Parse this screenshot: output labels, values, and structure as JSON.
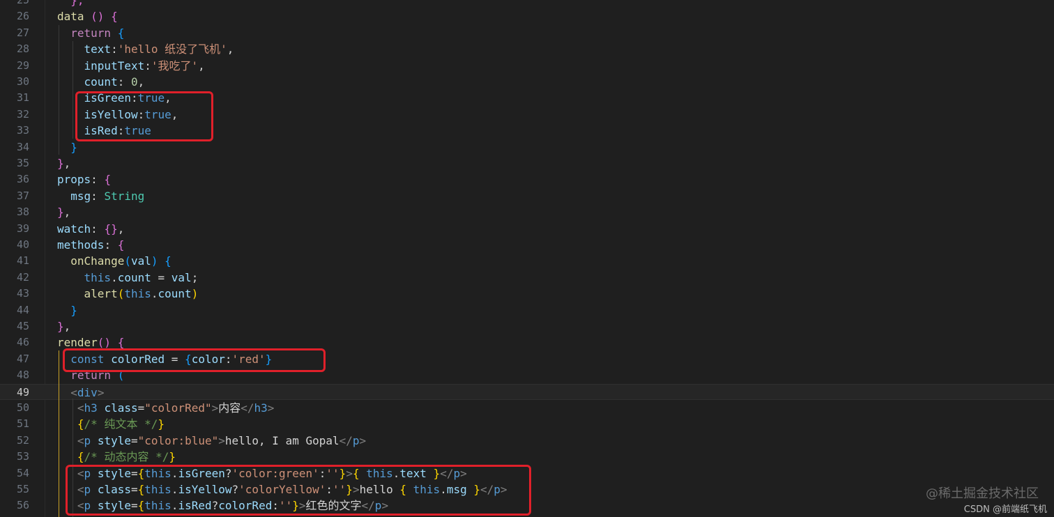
{
  "colors": {
    "background": "#1f1f1f",
    "plain": "#d4d4d4",
    "keyword": "#c586c0",
    "variable": "#9cdcfe",
    "function": "#dcdcaa",
    "string": "#ce9178",
    "boolean": "#569cd6",
    "number": "#b5cea8",
    "type": "#4ec9b0",
    "bracket1": "#ffd700",
    "bracket2": "#da70d6",
    "bracket3": "#179fff",
    "tag": "#569cd6",
    "tagAngle": "#808080",
    "attr": "#9cdcfe",
    "comment": "#6a9955",
    "highlight_box": "#e0202a"
  },
  "lines": [
    {
      "n": "25",
      "t": [
        [
          "  ",
          "plain"
        ],
        [
          "},",
          "bracket2"
        ]
      ]
    },
    {
      "n": "26",
      "t": [
        [
          "data",
          "function"
        ],
        [
          " ",
          "plain"
        ],
        [
          "()",
          "bracket2"
        ],
        [
          " ",
          "plain"
        ],
        [
          "{",
          "bracket2"
        ]
      ]
    },
    {
      "n": "27",
      "t": [
        [
          "  ",
          "plain"
        ],
        [
          "return",
          "keyword"
        ],
        [
          " ",
          "plain"
        ],
        [
          "{",
          "bracket3"
        ]
      ]
    },
    {
      "n": "28",
      "t": [
        [
          "    ",
          "plain"
        ],
        [
          "text",
          "variable"
        ],
        [
          ":",
          "plain"
        ],
        [
          "'hello 纸没了飞机'",
          "string"
        ],
        [
          ",",
          "plain"
        ]
      ]
    },
    {
      "n": "29",
      "t": [
        [
          "    ",
          "plain"
        ],
        [
          "inputText",
          "variable"
        ],
        [
          ":",
          "plain"
        ],
        [
          "'我吃了'",
          "string"
        ],
        [
          ",",
          "plain"
        ]
      ]
    },
    {
      "n": "30",
      "t": [
        [
          "    ",
          "plain"
        ],
        [
          "count",
          "variable"
        ],
        [
          ": ",
          "plain"
        ],
        [
          "0",
          "number"
        ],
        [
          ",",
          "plain"
        ]
      ]
    },
    {
      "n": "31",
      "t": [
        [
          "    ",
          "plain"
        ],
        [
          "isGreen",
          "variable"
        ],
        [
          ":",
          "plain"
        ],
        [
          "true",
          "boolean"
        ],
        [
          ",",
          "plain"
        ]
      ]
    },
    {
      "n": "32",
      "t": [
        [
          "    ",
          "plain"
        ],
        [
          "isYellow",
          "variable"
        ],
        [
          ":",
          "plain"
        ],
        [
          "true",
          "boolean"
        ],
        [
          ",",
          "plain"
        ]
      ]
    },
    {
      "n": "33",
      "t": [
        [
          "    ",
          "plain"
        ],
        [
          "isRed",
          "variable"
        ],
        [
          ":",
          "plain"
        ],
        [
          "true",
          "boolean"
        ]
      ]
    },
    {
      "n": "34",
      "t": [
        [
          "  ",
          "plain"
        ],
        [
          "}",
          "bracket3"
        ]
      ]
    },
    {
      "n": "35",
      "t": [
        [
          "}",
          "bracket2"
        ],
        [
          ",",
          "plain"
        ]
      ]
    },
    {
      "n": "36",
      "t": [
        [
          "props",
          "variable"
        ],
        [
          ": ",
          "plain"
        ],
        [
          "{",
          "bracket2"
        ]
      ]
    },
    {
      "n": "37",
      "t": [
        [
          "  ",
          "plain"
        ],
        [
          "msg",
          "variable"
        ],
        [
          ": ",
          "plain"
        ],
        [
          "String",
          "type"
        ]
      ]
    },
    {
      "n": "38",
      "t": [
        [
          "}",
          "bracket2"
        ],
        [
          ",",
          "plain"
        ]
      ]
    },
    {
      "n": "39",
      "t": [
        [
          "watch",
          "variable"
        ],
        [
          ": ",
          "plain"
        ],
        [
          "{}",
          "bracket2"
        ],
        [
          ",",
          "plain"
        ]
      ]
    },
    {
      "n": "40",
      "t": [
        [
          "methods",
          "variable"
        ],
        [
          ": ",
          "plain"
        ],
        [
          "{",
          "bracket2"
        ]
      ]
    },
    {
      "n": "41",
      "t": [
        [
          "  ",
          "plain"
        ],
        [
          "onChange",
          "function"
        ],
        [
          "(",
          "bracket3"
        ],
        [
          "val",
          "variable"
        ],
        [
          ")",
          "bracket3"
        ],
        [
          " ",
          "plain"
        ],
        [
          "{",
          "bracket3"
        ]
      ]
    },
    {
      "n": "42",
      "t": [
        [
          "    ",
          "plain"
        ],
        [
          "this",
          "boolean"
        ],
        [
          ".",
          "plain"
        ],
        [
          "count",
          "variable"
        ],
        [
          " = ",
          "plain"
        ],
        [
          "val",
          "variable"
        ],
        [
          ";",
          "plain"
        ]
      ]
    },
    {
      "n": "43",
      "t": [
        [
          "    ",
          "plain"
        ],
        [
          "alert",
          "function"
        ],
        [
          "(",
          "bracket1"
        ],
        [
          "this",
          "boolean"
        ],
        [
          ".",
          "plain"
        ],
        [
          "count",
          "variable"
        ],
        [
          ")",
          "bracket1"
        ]
      ]
    },
    {
      "n": "44",
      "t": [
        [
          "  ",
          "plain"
        ],
        [
          "}",
          "bracket3"
        ]
      ]
    },
    {
      "n": "45",
      "t": [
        [
          "}",
          "bracket2"
        ],
        [
          ",",
          "plain"
        ]
      ]
    },
    {
      "n": "46",
      "t": [
        [
          "render",
          "function"
        ],
        [
          "()",
          "bracket2"
        ],
        [
          " ",
          "plain"
        ],
        [
          "{",
          "bracket2"
        ]
      ]
    },
    {
      "n": "47",
      "t": [
        [
          "  ",
          "plain"
        ],
        [
          "const",
          "boolean"
        ],
        [
          " ",
          "plain"
        ],
        [
          "colorRed",
          "variable"
        ],
        [
          " = ",
          "plain"
        ],
        [
          "{",
          "bracket3"
        ],
        [
          "color",
          "variable"
        ],
        [
          ":",
          "plain"
        ],
        [
          "'red'",
          "string"
        ],
        [
          "}",
          "bracket3"
        ]
      ]
    },
    {
      "n": "48",
      "t": [
        [
          "  ",
          "plain"
        ],
        [
          "return",
          "keyword"
        ],
        [
          " ",
          "plain"
        ],
        [
          "(",
          "bracket3"
        ]
      ]
    },
    {
      "n": "49",
      "t": [
        [
          "  ",
          "plain"
        ],
        [
          "<",
          "tagAngle"
        ],
        [
          "div",
          "tag"
        ],
        [
          ">",
          "tagAngle"
        ]
      ],
      "active": true
    },
    {
      "n": "50",
      "t": [
        [
          "   ",
          "plain"
        ],
        [
          "<",
          "tagAngle"
        ],
        [
          "h3",
          "tag"
        ],
        [
          " ",
          "plain"
        ],
        [
          "class",
          "attr"
        ],
        [
          "=",
          "plain"
        ],
        [
          "\"colorRed\"",
          "string"
        ],
        [
          ">",
          "tagAngle"
        ],
        [
          "内容",
          "plain"
        ],
        [
          "</",
          "tagAngle"
        ],
        [
          "h3",
          "tag"
        ],
        [
          ">",
          "tagAngle"
        ]
      ]
    },
    {
      "n": "51",
      "t": [
        [
          "   ",
          "plain"
        ],
        [
          "{",
          "bracket1"
        ],
        [
          "/* 纯文本 */",
          "comment"
        ],
        [
          "}",
          "bracket1"
        ]
      ]
    },
    {
      "n": "52",
      "t": [
        [
          "   ",
          "plain"
        ],
        [
          "<",
          "tagAngle"
        ],
        [
          "p",
          "tag"
        ],
        [
          " ",
          "plain"
        ],
        [
          "style",
          "attr"
        ],
        [
          "=",
          "plain"
        ],
        [
          "\"color:blue\"",
          "string"
        ],
        [
          ">",
          "tagAngle"
        ],
        [
          "hello, I am Gopal",
          "plain"
        ],
        [
          "</",
          "tagAngle"
        ],
        [
          "p",
          "tag"
        ],
        [
          ">",
          "tagAngle"
        ]
      ]
    },
    {
      "n": "53",
      "t": [
        [
          "   ",
          "plain"
        ],
        [
          "{",
          "bracket1"
        ],
        [
          "/* 动态内容 */",
          "comment"
        ],
        [
          "}",
          "bracket1"
        ]
      ]
    },
    {
      "n": "54",
      "t": [
        [
          "   ",
          "plain"
        ],
        [
          "<",
          "tagAngle"
        ],
        [
          "p",
          "tag"
        ],
        [
          " ",
          "plain"
        ],
        [
          "style",
          "attr"
        ],
        [
          "=",
          "plain"
        ],
        [
          "{",
          "bracket1"
        ],
        [
          "this",
          "boolean"
        ],
        [
          ".",
          "plain"
        ],
        [
          "isGreen",
          "variable"
        ],
        [
          "?",
          "plain"
        ],
        [
          "'color:green'",
          "string"
        ],
        [
          ":",
          "plain"
        ],
        [
          "''",
          "string"
        ],
        [
          "}",
          "bracket1"
        ],
        [
          ">",
          "tagAngle"
        ],
        [
          "{",
          "bracket1"
        ],
        [
          " ",
          "plain"
        ],
        [
          "this",
          "boolean"
        ],
        [
          ".",
          "plain"
        ],
        [
          "text",
          "variable"
        ],
        [
          " ",
          "plain"
        ],
        [
          "}",
          "bracket1"
        ],
        [
          "</",
          "tagAngle"
        ],
        [
          "p",
          "tag"
        ],
        [
          ">",
          "tagAngle"
        ]
      ]
    },
    {
      "n": "55",
      "t": [
        [
          "   ",
          "plain"
        ],
        [
          "<",
          "tagAngle"
        ],
        [
          "p",
          "tag"
        ],
        [
          " ",
          "plain"
        ],
        [
          "class",
          "attr"
        ],
        [
          "=",
          "plain"
        ],
        [
          "{",
          "bracket1"
        ],
        [
          "this",
          "boolean"
        ],
        [
          ".",
          "plain"
        ],
        [
          "isYellow",
          "variable"
        ],
        [
          "?",
          "plain"
        ],
        [
          "'colorYellow'",
          "string"
        ],
        [
          ":",
          "plain"
        ],
        [
          "''",
          "string"
        ],
        [
          "}",
          "bracket1"
        ],
        [
          ">",
          "tagAngle"
        ],
        [
          "hello ",
          "plain"
        ],
        [
          "{",
          "bracket1"
        ],
        [
          " ",
          "plain"
        ],
        [
          "this",
          "boolean"
        ],
        [
          ".",
          "plain"
        ],
        [
          "msg",
          "variable"
        ],
        [
          " ",
          "plain"
        ],
        [
          "}",
          "bracket1"
        ],
        [
          "</",
          "tagAngle"
        ],
        [
          "p",
          "tag"
        ],
        [
          ">",
          "tagAngle"
        ]
      ]
    },
    {
      "n": "56",
      "t": [
        [
          "   ",
          "plain"
        ],
        [
          "<",
          "tagAngle"
        ],
        [
          "p",
          "tag"
        ],
        [
          " ",
          "plain"
        ],
        [
          "style",
          "attr"
        ],
        [
          "=",
          "plain"
        ],
        [
          "{",
          "bracket1"
        ],
        [
          "this",
          "boolean"
        ],
        [
          ".",
          "plain"
        ],
        [
          "isRed",
          "variable"
        ],
        [
          "?",
          "plain"
        ],
        [
          "colorRed",
          "variable"
        ],
        [
          ":",
          "plain"
        ],
        [
          "''",
          "string"
        ],
        [
          "}",
          "bracket1"
        ],
        [
          ">",
          "tagAngle"
        ],
        [
          "红色的文字",
          "plain"
        ],
        [
          "</",
          "tagAngle"
        ],
        [
          "p",
          "tag"
        ],
        [
          ">",
          "tagAngle"
        ]
      ]
    }
  ],
  "watermark": {
    "primary": "@稀土掘金技术社区",
    "secondary": "CSDN @前端纸飞机"
  }
}
